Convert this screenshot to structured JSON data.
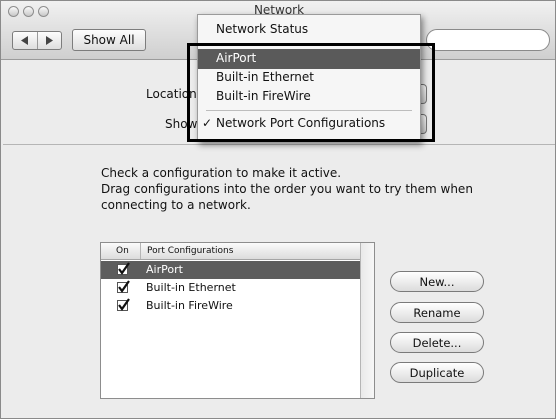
{
  "window": {
    "title": "Network"
  },
  "toolbar": {
    "show_all": "Show All",
    "back_icon": "triangle-left",
    "forward_icon": "triangle-right"
  },
  "settings": {
    "location_label": "Location:",
    "show_label": "Show:"
  },
  "popup_menu": {
    "items": [
      {
        "label": "Network Status",
        "selected": false,
        "highlighted": false
      },
      {
        "label": "AirPort",
        "selected": false,
        "highlighted": true
      },
      {
        "label": "Built-in Ethernet",
        "selected": false,
        "highlighted": false
      },
      {
        "label": "Built-in FireWire",
        "selected": false,
        "highlighted": false
      },
      {
        "label": "Network Port Configurations",
        "selected": true,
        "highlighted": false
      }
    ],
    "checkmark": "✓"
  },
  "instructions": {
    "lines": [
      "Check a configuration to make it active.",
      "Drag configurations into the order you want to try them when",
      "connecting to a network."
    ]
  },
  "port_list": {
    "columns": [
      "On",
      "Port Configurations"
    ],
    "rows": [
      {
        "on": true,
        "name": "AirPort",
        "selected": true
      },
      {
        "on": true,
        "name": "Built-in Ethernet",
        "selected": false
      },
      {
        "on": true,
        "name": "Built-in FireWire",
        "selected": false
      }
    ]
  },
  "buttons": {
    "new": "New...",
    "rename": "Rename",
    "delete": "Delete...",
    "duplicate": "Duplicate"
  },
  "colors": {
    "highlight": "#5a5a5a",
    "callout_border": "#000000"
  }
}
